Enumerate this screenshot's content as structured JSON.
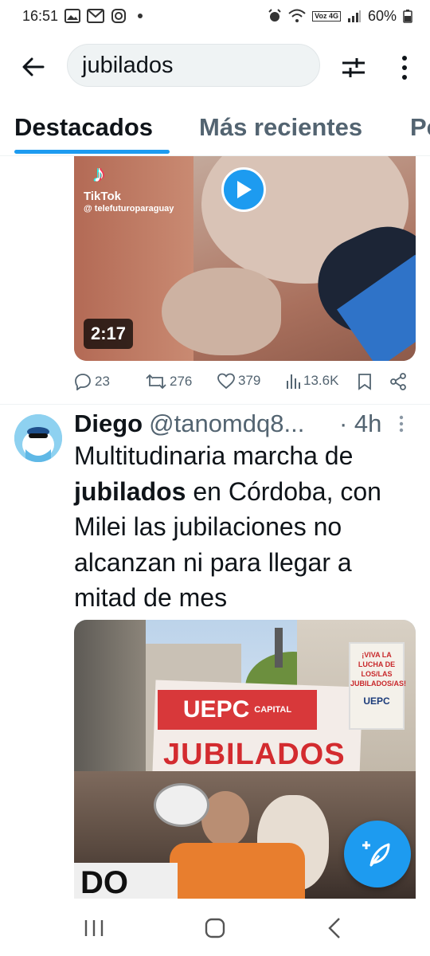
{
  "status_bar": {
    "time": "16:51",
    "battery": "60%",
    "network": "Voz 4G"
  },
  "search": {
    "query": "jubilados"
  },
  "tabs": [
    {
      "label": "Destacados",
      "active": true
    },
    {
      "label": "Más recientes",
      "active": false
    },
    {
      "label": "Pe",
      "active": false
    }
  ],
  "tweet1": {
    "video": {
      "tiktok_label": "TikTok",
      "tiktok_handle": "@ telefuturoparaguay",
      "duration": "2:17"
    },
    "stats": {
      "replies": "23",
      "reposts": "276",
      "likes": "379",
      "views": "13.6K"
    }
  },
  "tweet2": {
    "author_name": "Diego",
    "author_handle": "@tanomdq8...",
    "time": "· 4h",
    "text_before": "Multitudinaria marcha de ",
    "text_bold": "jubilados",
    "text_after": " en Córdoba, con Milei las jubilaciones no alcanzan ni para llegar a mitad de mes",
    "photo": {
      "banner_brand": "UEPC",
      "banner_sub": "CAPITAL",
      "banner_text": "JUBILADOS",
      "sign_text": "¡VIVA LA LUCHA DE LOS/LAS JUBILADOS/AS!",
      "sign_brand": "UEPC",
      "front_sign": "DO"
    }
  },
  "colors": {
    "accent": "#1d9bf0",
    "text": "#0f1419",
    "muted": "#536471"
  }
}
